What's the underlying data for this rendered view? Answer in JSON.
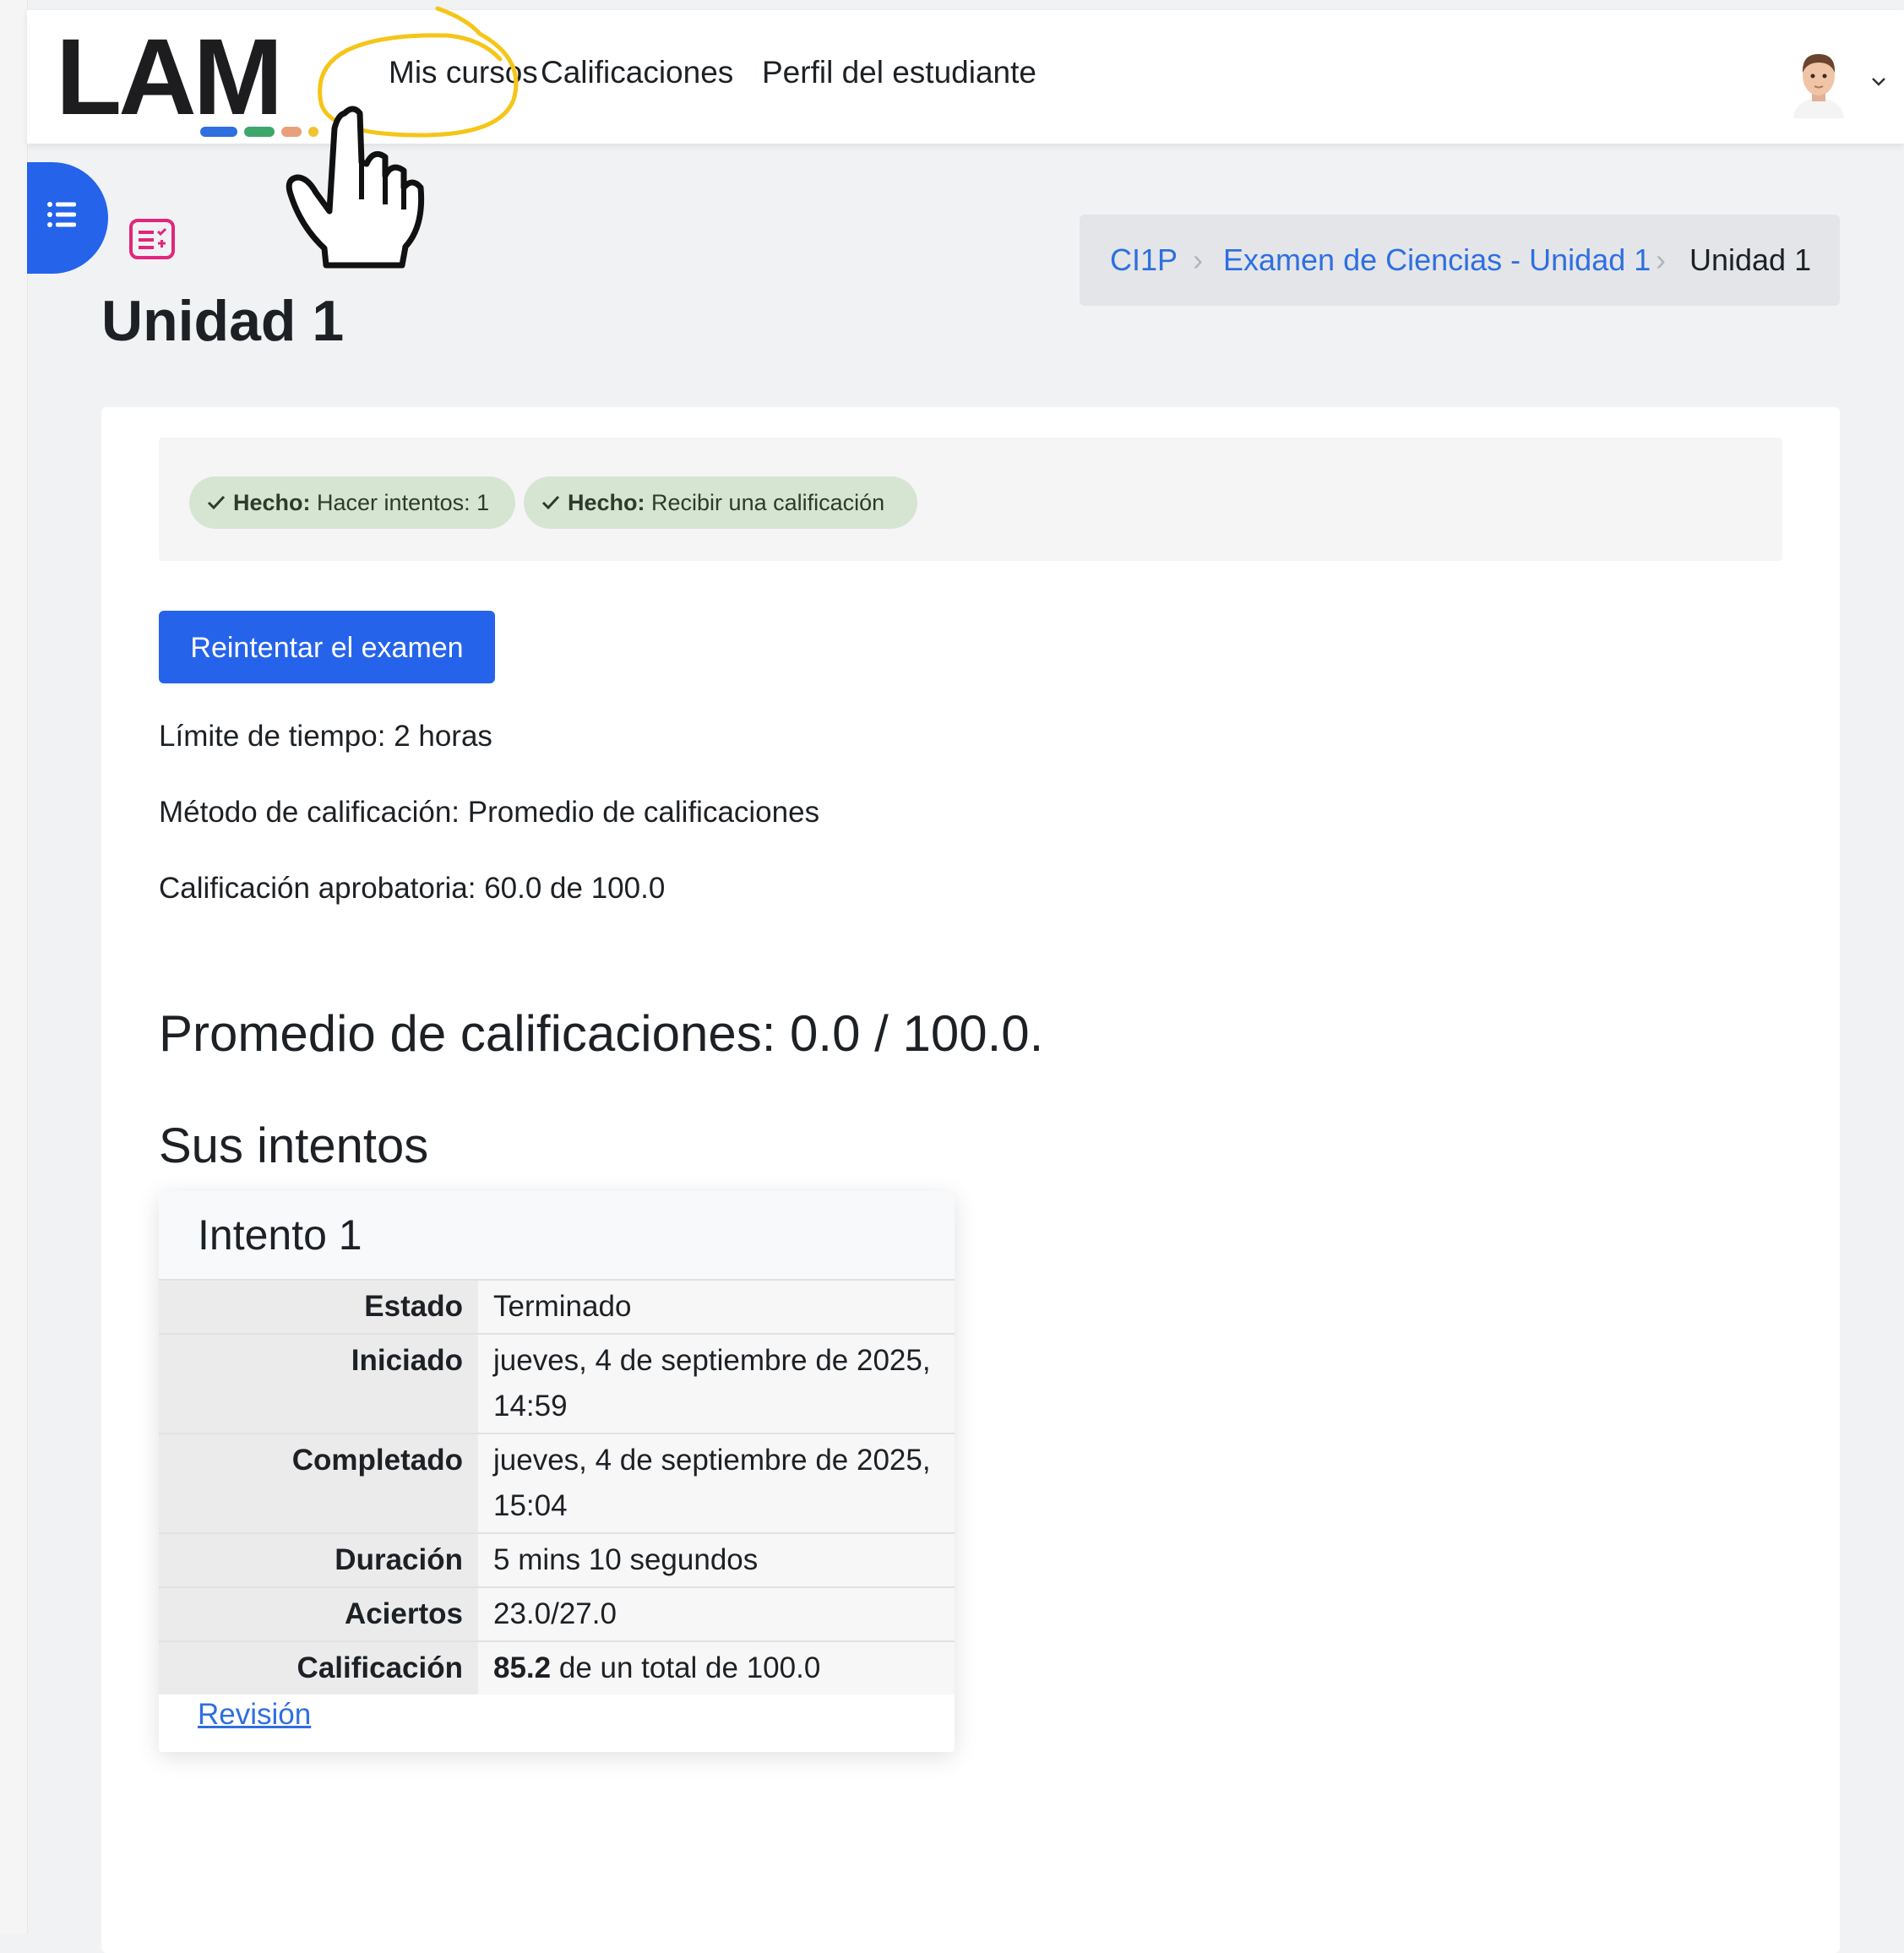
{
  "brand": {
    "logo_text": "LAM",
    "dot_colors": [
      "#2f6fdf",
      "#3ea66b",
      "#e8a07a",
      "#f2c230"
    ]
  },
  "nav": {
    "items": [
      "Mis cursos",
      "Calificaciones",
      "Perfil del estudiante"
    ]
  },
  "annotation": {
    "highlight_color": "#f5c518"
  },
  "icons": {
    "drawer": "list-icon",
    "quiz": "quiz-icon",
    "user_menu": "chevron-down-icon",
    "pointer": "hand-pointer-icon"
  },
  "breadcrumb": {
    "items": [
      "CI1P",
      "Examen de Ciencias - Unidad 1",
      "Unidad 1"
    ]
  },
  "page": {
    "title": "Unidad 1"
  },
  "completion": {
    "items": [
      {
        "status": "Hecho:",
        "text": "Hacer intentos: 1"
      },
      {
        "status": "Hecho:",
        "text": "Recibir una calificación"
      }
    ]
  },
  "actions": {
    "retry_label": "Reintentar el examen"
  },
  "quiz_info": {
    "time_limit": "Límite de tiempo: 2 horas",
    "grading_method": "Método de calificación: Promedio de calificaciones",
    "pass_grade": "Calificación aprobatoria: 60.0 de 100.0"
  },
  "summary": {
    "average": "Promedio de calificaciones: 0.0 / 100.0.",
    "attempts_heading": "Sus intentos"
  },
  "attempt": {
    "title": "Intento 1",
    "rows": [
      {
        "label": "Estado",
        "value": "Terminado"
      },
      {
        "label": "Iniciado",
        "value": "jueves, 4 de septiembre de 2025, 14:59"
      },
      {
        "label": "Completado",
        "value": "jueves, 4 de septiembre de 2025, 15:04"
      },
      {
        "label": "Duración",
        "value": "5 mins 10 segundos"
      },
      {
        "label": "Aciertos",
        "value": "23.0/27.0"
      },
      {
        "label": "Calificación",
        "value_bold": "85.2",
        "value": " de un total de 100.0"
      }
    ],
    "review_label": "Revisión"
  },
  "colors": {
    "primary": "#2563eb",
    "success_pill": "#d5e5d1",
    "link": "#2f6fdf"
  }
}
